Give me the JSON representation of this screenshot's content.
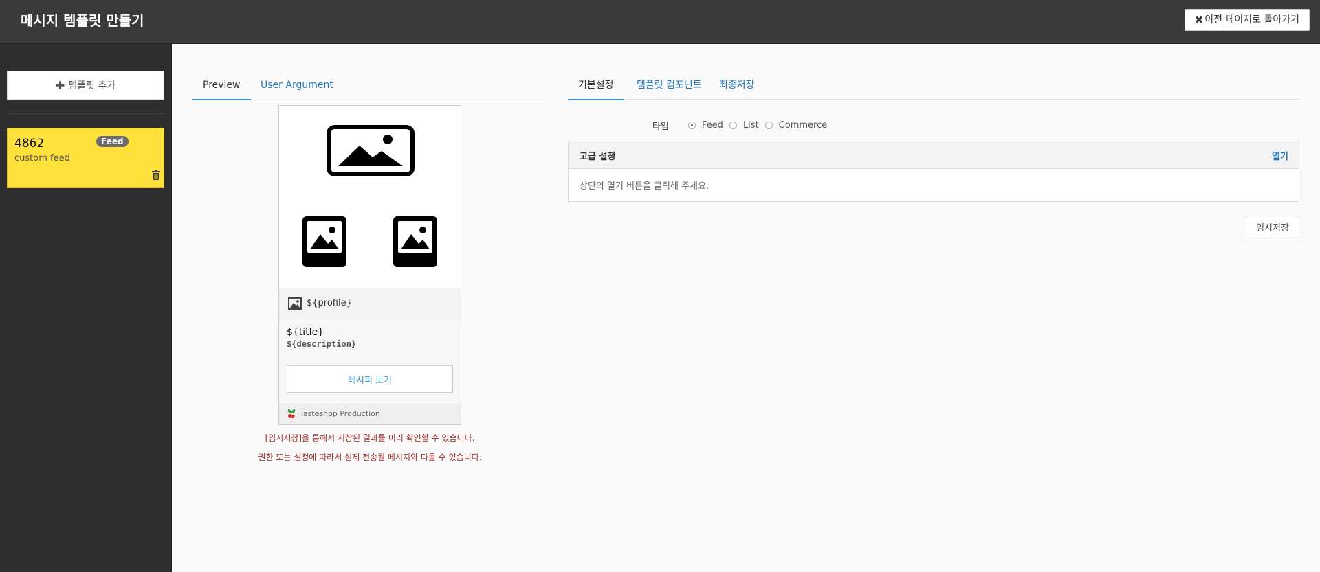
{
  "header": {
    "title": "메시지 템플릿 만들기",
    "back_button": "이전 페이지로 돌아가기"
  },
  "sidebar": {
    "add_button": "템플릿 추가",
    "templates": [
      {
        "id": "4862",
        "name": "custom feed",
        "badge": "Feed"
      }
    ]
  },
  "preview": {
    "tabs": [
      "Preview",
      "User Argument"
    ],
    "profile": "${profile}",
    "title": "${title}",
    "description": "${description}",
    "button": "레시피 보기",
    "footer": "Tasteshop Production",
    "notes": [
      "[임시저장]을 통해서 저장된 결과를 미리 확인할 수 있습니다.",
      "권한 또는 설정에 따라서 실제 전송될 메시지와 다를 수 있습니다."
    ]
  },
  "settings": {
    "tabs": [
      "기본설정",
      "템플릿 컴포넌트",
      "최종저장"
    ],
    "type_label": "타입",
    "type_options": [
      "Feed",
      "List",
      "Commerce"
    ],
    "type_selected": "Feed",
    "advanced": {
      "title": "고급 설정",
      "open_label": "열기",
      "message": "상단의 열기 버튼을 클릭해 주세요."
    },
    "temp_save": "임시저장"
  },
  "colors": {
    "topbar": "#3a3a3a",
    "sidebar": "#2e2e2e",
    "card": "#ffe13e",
    "accent": "#2278bd",
    "note": "#a03030"
  }
}
